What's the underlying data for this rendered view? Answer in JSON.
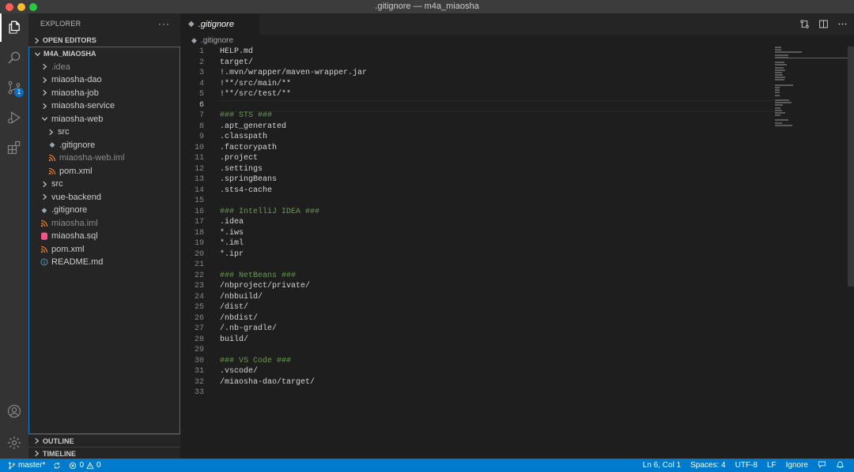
{
  "window": {
    "title": ".gitignore — m4a_miaosha"
  },
  "activity": {
    "items": [
      {
        "icon": "files-icon",
        "active": true
      },
      {
        "icon": "search-icon"
      },
      {
        "icon": "source-control-icon",
        "badge": "1"
      },
      {
        "icon": "run-debug-icon"
      },
      {
        "icon": "extensions-icon"
      }
    ],
    "bottom": [
      {
        "icon": "account-icon"
      },
      {
        "icon": "gear-icon"
      }
    ]
  },
  "sidebar": {
    "title": "EXPLORER",
    "more": "···",
    "open_editors": "OPEN EDITORS",
    "root": "M4A_MIAOSHA",
    "tree": [
      {
        "label": ".idea",
        "kind": "folder",
        "indent": 1,
        "dim": true
      },
      {
        "label": "miaosha-dao",
        "kind": "folder",
        "indent": 1
      },
      {
        "label": "miaosha-job",
        "kind": "folder",
        "indent": 1
      },
      {
        "label": "miaosha-service",
        "kind": "folder",
        "indent": 1
      },
      {
        "label": "miaosha-web",
        "kind": "folder-open",
        "indent": 1
      },
      {
        "label": "src",
        "kind": "folder",
        "indent": 2
      },
      {
        "label": ".gitignore",
        "kind": "gitignore",
        "indent": 2
      },
      {
        "label": "miaosha-web.iml",
        "kind": "rss",
        "indent": 2,
        "dim": true
      },
      {
        "label": "pom.xml",
        "kind": "rss",
        "indent": 2
      },
      {
        "label": "src",
        "kind": "folder",
        "indent": 1
      },
      {
        "label": "vue-backend",
        "kind": "folder",
        "indent": 1
      },
      {
        "label": ".gitignore",
        "kind": "gitignore",
        "indent": 1
      },
      {
        "label": "miaosha.iml",
        "kind": "rss",
        "indent": 1,
        "dim": true
      },
      {
        "label": "miaosha.sql",
        "kind": "db",
        "indent": 1
      },
      {
        "label": "pom.xml",
        "kind": "rss",
        "indent": 1
      },
      {
        "label": "README.md",
        "kind": "info",
        "indent": 1
      }
    ],
    "outline": "OUTLINE",
    "timeline": "TIMELINE"
  },
  "editor": {
    "tab_label": ".gitignore",
    "breadcrumb": ".gitignore",
    "current_line": 6,
    "lines": [
      "HELP.md",
      "target/",
      "!.mvn/wrapper/maven-wrapper.jar",
      "!**/src/main/**",
      "!**/src/test/**",
      "",
      "### STS ###",
      ".apt_generated",
      ".classpath",
      ".factorypath",
      ".project",
      ".settings",
      ".springBeans",
      ".sts4-cache",
      "",
      "### IntelliJ IDEA ###",
      ".idea",
      "*.iws",
      "*.iml",
      "*.ipr",
      "",
      "### NetBeans ###",
      "/nbproject/private/",
      "/nbbuild/",
      "/dist/",
      "/nbdist/",
      "/.nb-gradle/",
      "build/",
      "",
      "### VS Code ###",
      ".vscode/",
      "/miaosha-dao/target/",
      ""
    ]
  },
  "status": {
    "branch": "master*",
    "errors": "0",
    "warnings": "0",
    "position": "Ln 6, Col 1",
    "spaces": "Spaces: 4",
    "encoding": "UTF-8",
    "eol": "LF",
    "language": "Ignore"
  },
  "colors": {
    "accent": "#007acc",
    "comment": "#6a9955",
    "rss_orange": "#e37933",
    "db_red": "#f55385",
    "info_blue": "#519aba"
  }
}
